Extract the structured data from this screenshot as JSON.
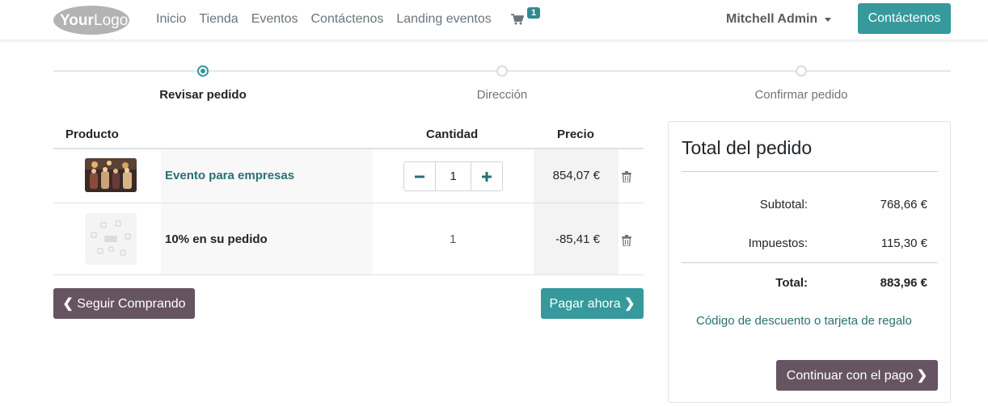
{
  "header": {
    "logo_text": "YourLogo",
    "nav": [
      "Inicio",
      "Tienda",
      "Eventos",
      "Contáctenos",
      "Landing eventos"
    ],
    "cart_count": "1",
    "user_name": "Mitchell Admin",
    "cta_label": "Contáctenos"
  },
  "steps": [
    {
      "label": "Revisar pedido",
      "active": true
    },
    {
      "label": "Dirección",
      "active": false
    },
    {
      "label": "Confirmar pedido",
      "active": false
    }
  ],
  "cart": {
    "headers": {
      "product": "Producto",
      "quantity": "Cantidad",
      "price": "Precio"
    },
    "lines": [
      {
        "name": "Evento para empresas",
        "quantity": "1",
        "price": "854,07 €",
        "editable": true
      },
      {
        "name": "10% en su pedido",
        "quantity": "1",
        "price": "-85,41 €",
        "editable": false
      }
    ],
    "back_label": "Seguir Comprando",
    "pay_label": "Pagar ahora"
  },
  "summary": {
    "title": "Total del pedido",
    "subtotal_label": "Subtotal:",
    "subtotal": "768,66 €",
    "taxes_label": "Impuestos:",
    "taxes": "115,30 €",
    "total_label": "Total:",
    "total": "883,96 €",
    "discount_link": "Código de descuento o tarjeta de regalo",
    "continue_label": "Continuar con el pago"
  },
  "colors": {
    "primary": "#36999b",
    "secondary": "#665462",
    "link": "#2a6f74"
  }
}
